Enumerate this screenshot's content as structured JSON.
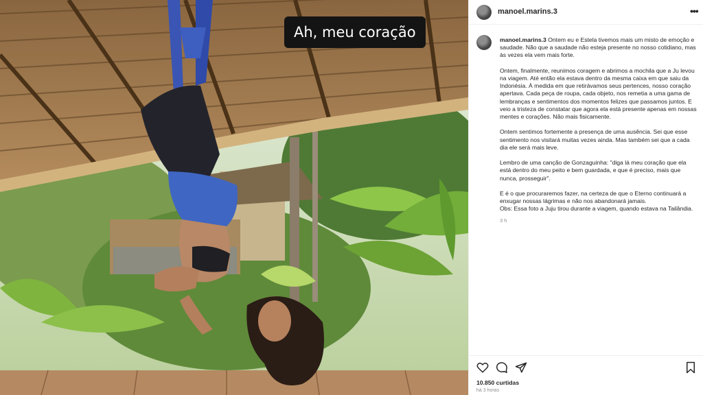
{
  "photo": {
    "overlay_caption": "Ah, meu coração"
  },
  "post": {
    "username": "manoel.marins.3",
    "more_icon": "ellipsis-icon",
    "caption_paragraphs": [
      "Ontem eu e Estela tivemos mais um misto de emoção e saudade. Não que a saudade não esteja presente no nosso cotidiano, mas às vezes ela vem mais forte.",
      "Ontem, finalmente, reunimos coragem e abrimos a mochila que a Ju levou na viagem. Até então ela estava dentro da mesma caixa em que saiu da Indonésia. À medida em que retirávamos seus pertences, nosso coração apertava. Cada peça de roupa, cada objeto, nos remetia a uma gama de lembranças e sentimentos dos momentos felizes que passamos juntos. E veio a tristeza de constatar que agora ela está presente apenas em nossas mentes e corações. Não mais fisicamente.",
      "Ontem sentimos fortemente a presença de uma ausência. Sei que esse sentimento nos visitará muitas vezes ainda. Mas também sei que a cada dia ele será mais leve.",
      "Lembro de uma canção de Gonzaguinha: \"diga lá meu coração que ela está dentro do meu peito e bem guardada, e que é preciso, mais que nunca, prosseguir\".",
      "E é o que procuraremos fazer, na certeza de que o Eterno continuará a enxugar nossas lágrimas e não nos abandonará jamais.",
      "Obs: Essa foto a Juju tirou durante a viagem, quando estava na Tailândia."
    ],
    "caption_age": "3 h",
    "likes": "10.850 curtidas",
    "age": "há 3 horas",
    "icons": {
      "like": "heart-icon",
      "comment": "comment-icon",
      "share": "send-icon",
      "save": "bookmark-icon"
    }
  }
}
